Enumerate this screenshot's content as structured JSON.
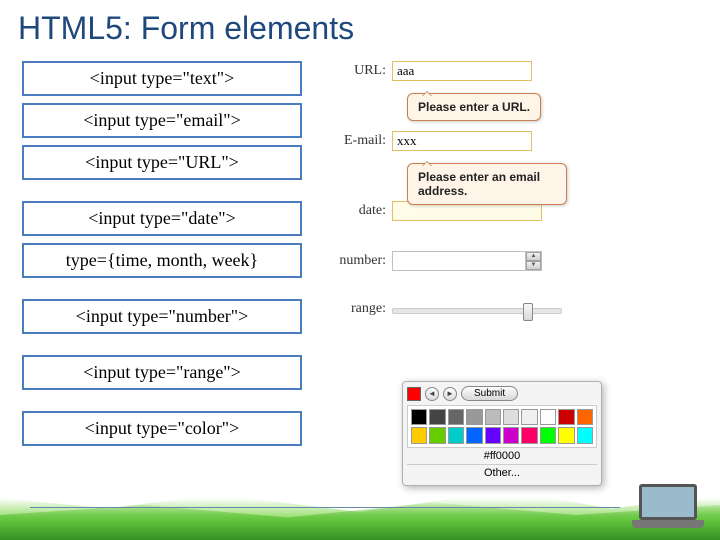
{
  "title": "HTML5: Form elements",
  "left": {
    "items": [
      "<input type=\"text\">",
      "<input type=\"email\">",
      "<input type=\"URL\">",
      "<input type=\"date\">",
      "type={time, month, week}",
      "<input type=\"number\">",
      "<input type=\"range\">",
      "<input type=\"color\">"
    ]
  },
  "form": {
    "url": {
      "label": "URL:",
      "value": "aaa",
      "tooltip": "Please enter a URL."
    },
    "email": {
      "label": "E-mail:",
      "value": "xxx",
      "tooltip": "Please enter an email address."
    },
    "date": {
      "label": "date:"
    },
    "number": {
      "label": "number:"
    },
    "range": {
      "label": "range:"
    }
  },
  "colorPicker": {
    "submit": "Submit",
    "hex": "#ff0000",
    "other": "Other...",
    "colors": [
      "#000000",
      "#444444",
      "#666666",
      "#999999",
      "#bbbbbb",
      "#dddddd",
      "#f0f0f0",
      "#ffffff",
      "#cc0000",
      "#ff6600",
      "#ffcc00",
      "#66cc00",
      "#00cccc",
      "#0066ff",
      "#6600ff",
      "#cc00cc",
      "#ff0066",
      "#00ff00",
      "#ffff00",
      "#00ffff"
    ]
  }
}
